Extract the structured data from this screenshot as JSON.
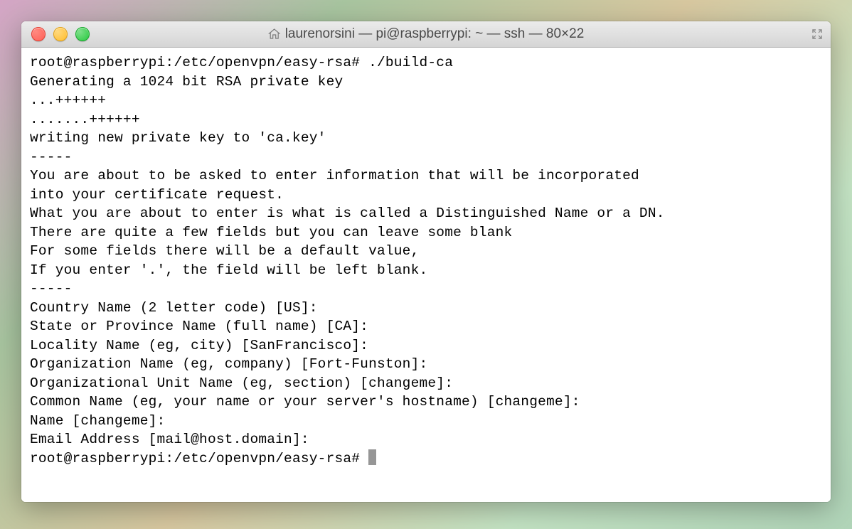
{
  "window": {
    "title": "laurenorsini — pi@raspberrypi: ~ — ssh — 80×22"
  },
  "terminal": {
    "lines": [
      "root@raspberrypi:/etc/openvpn/easy-rsa# ./build-ca",
      "Generating a 1024 bit RSA private key",
      "...++++++",
      ".......++++++",
      "writing new private key to 'ca.key'",
      "-----",
      "You are about to be asked to enter information that will be incorporated",
      "into your certificate request.",
      "What you are about to enter is what is called a Distinguished Name or a DN.",
      "There are quite a few fields but you can leave some blank",
      "For some fields there will be a default value,",
      "If you enter '.', the field will be left blank.",
      "-----",
      "Country Name (2 letter code) [US]:",
      "State or Province Name (full name) [CA]:",
      "Locality Name (eg, city) [SanFrancisco]:",
      "Organization Name (eg, company) [Fort-Funston]:",
      "Organizational Unit Name (eg, section) [changeme]:",
      "Common Name (eg, your name or your server's hostname) [changeme]:",
      "Name [changeme]:",
      "Email Address [mail@host.domain]:"
    ],
    "prompt": "root@raspberrypi:/etc/openvpn/easy-rsa# "
  }
}
